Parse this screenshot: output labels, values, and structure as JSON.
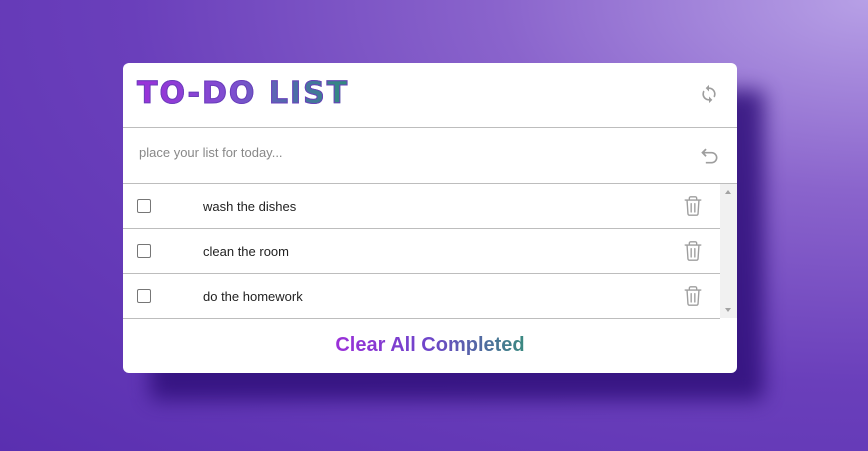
{
  "app": {
    "title": "TO-DO LIST"
  },
  "header": {
    "refresh_icon": "refresh-icon"
  },
  "input": {
    "placeholder": "place your list for today...",
    "value": "",
    "undo_icon": "undo-icon"
  },
  "todos": [
    {
      "text": "wash the dishes",
      "completed": false
    },
    {
      "text": "clean the room",
      "completed": false
    },
    {
      "text": "do the homework",
      "completed": false
    }
  ],
  "footer": {
    "clear_label": "Clear All Completed"
  },
  "colors": {
    "accent_purple": "#9b30d9",
    "accent_teal": "#2f8d7c",
    "icon_gray": "#9e9e9e",
    "background": "#6a3fbb"
  }
}
